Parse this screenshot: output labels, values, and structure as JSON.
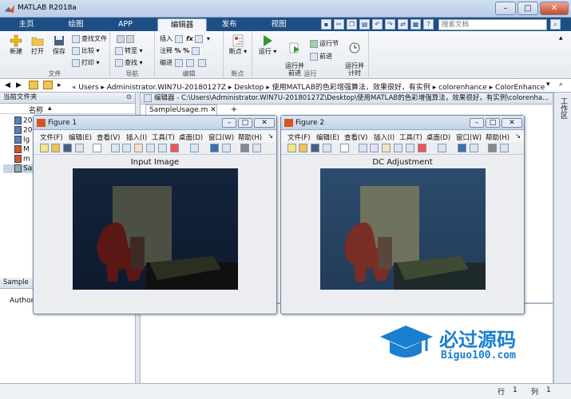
{
  "window": {
    "title": "MATLAB R2018a",
    "buttons": {
      "minimize": "–",
      "maximize": "□",
      "close": "✕"
    }
  },
  "tabs": [
    {
      "label": "主页"
    },
    {
      "label": "绘图"
    },
    {
      "label": "APP"
    },
    {
      "label": "编辑器",
      "active": true
    },
    {
      "label": "发布"
    },
    {
      "label": "视图"
    }
  ],
  "search": {
    "placeholder": "搜索文档"
  },
  "ribbon": {
    "file": {
      "label": "文件",
      "new": "新建",
      "open": "打开",
      "save": "保存",
      "find_files": "查找文件",
      "compare": "比较",
      "print": "打印"
    },
    "nav": {
      "label": "导航",
      "goto": "转至",
      "find": "查找"
    },
    "edit": {
      "label": "编辑",
      "insert": "插入",
      "comment": "注释",
      "indent": "缩进"
    },
    "breakpoints": {
      "label": "断点",
      "bp": "断点"
    },
    "run": {
      "label": "运行",
      "run": "运行",
      "run_adv": "运行并\n前进",
      "run_section": "运行节",
      "advance": "前进",
      "run_time": "运行并\n计时"
    }
  },
  "address": {
    "path": "« Users ▸ Administrator.WIN7U-20180127Z ▸ Desktop ▸ 使用MATLAB的色彩增强算法，效果很好，有实例 ▸ colorenhance ▸ ColorEnhance"
  },
  "current_folder": {
    "title": "当前文件夹",
    "column": "名称",
    "items": [
      "20",
      "20",
      "lg",
      "M",
      "m",
      "Sa"
    ]
  },
  "details": {
    "title": "Sample",
    "author_label": "Author"
  },
  "editor": {
    "header": "编辑器 - C:\\Users\\Administrator.WIN7U-20180127Z\\Desktop\\使用MATLAB的色彩增强算法，效果很好，有实例\\colorenha...",
    "tab": "SampleUsage.m",
    "add_tab": "+"
  },
  "right_strip": {
    "label": "工作区"
  },
  "figures": [
    {
      "name": "Figure 1",
      "axes_title": "Input Image"
    },
    {
      "name": "Figure 2",
      "axes_title": "DC Adjustment"
    }
  ],
  "fig_menu": [
    "文件(F)",
    "编辑(E)",
    "查看(V)",
    "插入(I)",
    "工具(T)",
    "桌面(D)",
    "窗口(W)",
    "帮助(H)"
  ],
  "status": {
    "row_label": "行",
    "row": "1",
    "col_label": "列",
    "col": "1"
  },
  "watermark": {
    "cn": "必过源码",
    "en": "Biguo100.com"
  },
  "colors": {
    "tab_bar": "#1e4e86",
    "accent_run": "#2f9a34",
    "watermark": "#1a7fd0"
  }
}
